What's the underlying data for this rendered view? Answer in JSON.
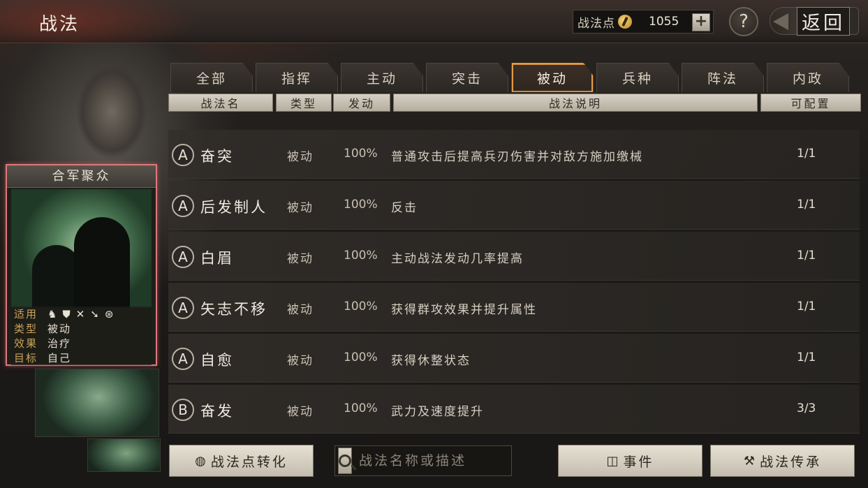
{
  "header": {
    "title": "战法",
    "points_label": "战法点",
    "points_value": "1055",
    "plus_label": "+",
    "help_label": "?",
    "back_label": "返回"
  },
  "tabs": [
    {
      "label": "全部",
      "active": false
    },
    {
      "label": "指挥",
      "active": false
    },
    {
      "label": "主动",
      "active": false
    },
    {
      "label": "突击",
      "active": false
    },
    {
      "label": "被动",
      "active": true
    },
    {
      "label": "兵种",
      "active": false
    },
    {
      "label": "阵法",
      "active": false
    },
    {
      "label": "内政",
      "active": false
    }
  ],
  "columns": {
    "name": "战法名",
    "type": "类型",
    "trigger": "发动",
    "desc": "战法说明",
    "available": "可配置"
  },
  "rows": [
    {
      "grade": "A",
      "name": "奋突",
      "type": "被动",
      "rate": "100%",
      "desc": "普通攻击后提高兵刃伤害并对敌方施加缴械",
      "count": "1/1"
    },
    {
      "grade": "A",
      "name": "后发制人",
      "type": "被动",
      "rate": "100%",
      "desc": "反击",
      "count": "1/1"
    },
    {
      "grade": "A",
      "name": "白眉",
      "type": "被动",
      "rate": "100%",
      "desc": "主动战法发动几率提高",
      "count": "1/1"
    },
    {
      "grade": "A",
      "name": "矢志不移",
      "type": "被动",
      "rate": "100%",
      "desc": "获得群攻效果并提升属性",
      "count": "1/1"
    },
    {
      "grade": "A",
      "name": "自愈",
      "type": "被动",
      "rate": "100%",
      "desc": "获得休整状态",
      "count": "1/1"
    },
    {
      "grade": "B",
      "name": "奋发",
      "type": "被动",
      "rate": "100%",
      "desc": "武力及速度提升",
      "count": "3/3"
    }
  ],
  "card": {
    "title": "合军聚众",
    "apply_label": "适用",
    "apply_icons": [
      "cavalry-icon",
      "shield-icon",
      "bow-crossed-icon",
      "spear-icon",
      "wheel-icon"
    ],
    "type_label": "类型",
    "type_value": "被动",
    "effect_label": "效果",
    "effect_value": "治疗",
    "target_label": "目标",
    "target_value": "自己"
  },
  "footer": {
    "convert_label": "战法点转化",
    "search_placeholder": "战法名称或描述",
    "event_label": "事件",
    "inherit_label": "战法传承"
  },
  "colors": {
    "active_tab_border": "#e09b45",
    "card_border": "#e0777a"
  }
}
